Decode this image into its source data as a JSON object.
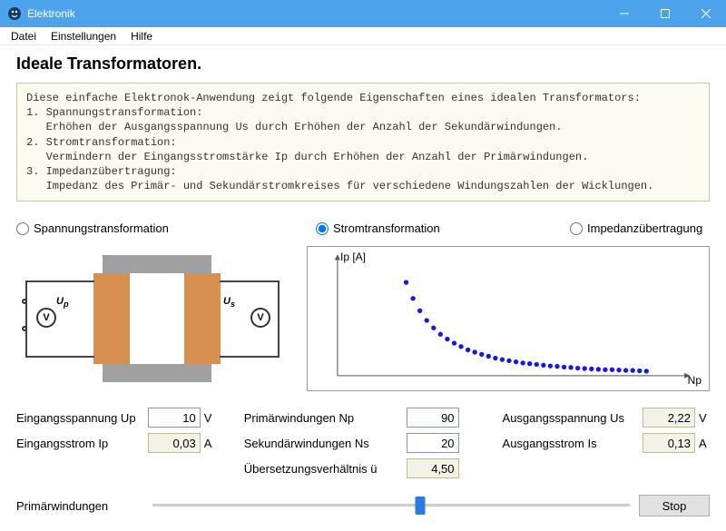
{
  "window": {
    "title": "Elektronik"
  },
  "menu": {
    "items": [
      "Datei",
      "Einstellungen",
      "Hilfe"
    ]
  },
  "heading": "Ideale Transformatoren.",
  "info_text": "Diese einfache Elektronok-Anwendung zeigt folgende Eigenschaften eines idealen Transformators:\n1. Spannungstransformation:\n   Erhöhen der Ausgangsspannung Us durch Erhöhen der Anzahl der Sekundärwindungen.\n2. Stromtransformation:\n   Vermindern der Eingangsstromstärke Ip durch Erhöhen der Anzahl der Primärwindungen.\n3. Impedanzübertragung:\n   Impedanz des Primär- und Sekundärstromkreises für verschiedene Windungszahlen der Wicklungen.",
  "radios": {
    "options": [
      "Spannungstransformation",
      "Stromtransformation",
      "Impedanzübertragung"
    ],
    "selected": 1
  },
  "diagram": {
    "u_p": "U",
    "u_p_sub": "p",
    "u_s": "U",
    "u_s_sub": "s",
    "v_symbol": "V"
  },
  "fields": {
    "col1": [
      {
        "label": "Eingangsspannung Up",
        "value": "10",
        "unit": "V",
        "readonly": false
      },
      {
        "label": "Eingangsstrom Ip",
        "value": "0,03",
        "unit": "A",
        "readonly": true
      }
    ],
    "col2": [
      {
        "label": "Primärwindungen Np",
        "value": "90",
        "unit": "",
        "readonly": false
      },
      {
        "label": "Sekundärwindungen Ns",
        "value": "20",
        "unit": "",
        "readonly": false
      },
      {
        "label": "Übersetzungsverhältnis ü",
        "value": "4,50",
        "unit": "",
        "readonly": true
      }
    ],
    "col3": [
      {
        "label": "Ausgangsspannung Us",
        "value": "2,22",
        "unit": "V",
        "readonly": true
      },
      {
        "label": "Ausgangsstrom Is",
        "value": "0,13",
        "unit": "A",
        "readonly": true
      }
    ]
  },
  "slider": {
    "label": "Primärwindungen",
    "position_pct": 56
  },
  "stop_button": "Stop",
  "chart_data": {
    "type": "scatter",
    "title": "",
    "xlabel": "Np",
    "ylabel": "Ip [A]",
    "xlim": [
      0,
      100
    ],
    "ylim": [
      0,
      0.3
    ],
    "series": [
      {
        "name": "Ip",
        "x": [
          20,
          22,
          24,
          26,
          28,
          30,
          32,
          34,
          36,
          38,
          40,
          42,
          44,
          46,
          48,
          50,
          52,
          54,
          56,
          58,
          60,
          62,
          64,
          66,
          68,
          70,
          72,
          74,
          76,
          78,
          80,
          82,
          84,
          86,
          88,
          90
        ],
        "y": [
          0.25,
          0.207,
          0.174,
          0.148,
          0.128,
          0.111,
          0.098,
          0.087,
          0.078,
          0.069,
          0.063,
          0.057,
          0.052,
          0.047,
          0.043,
          0.04,
          0.037,
          0.034,
          0.032,
          0.03,
          0.028,
          0.026,
          0.025,
          0.023,
          0.022,
          0.02,
          0.019,
          0.018,
          0.017,
          0.016,
          0.016,
          0.015,
          0.014,
          0.014,
          0.013,
          0.012
        ]
      }
    ],
    "color": "#1818e0"
  }
}
